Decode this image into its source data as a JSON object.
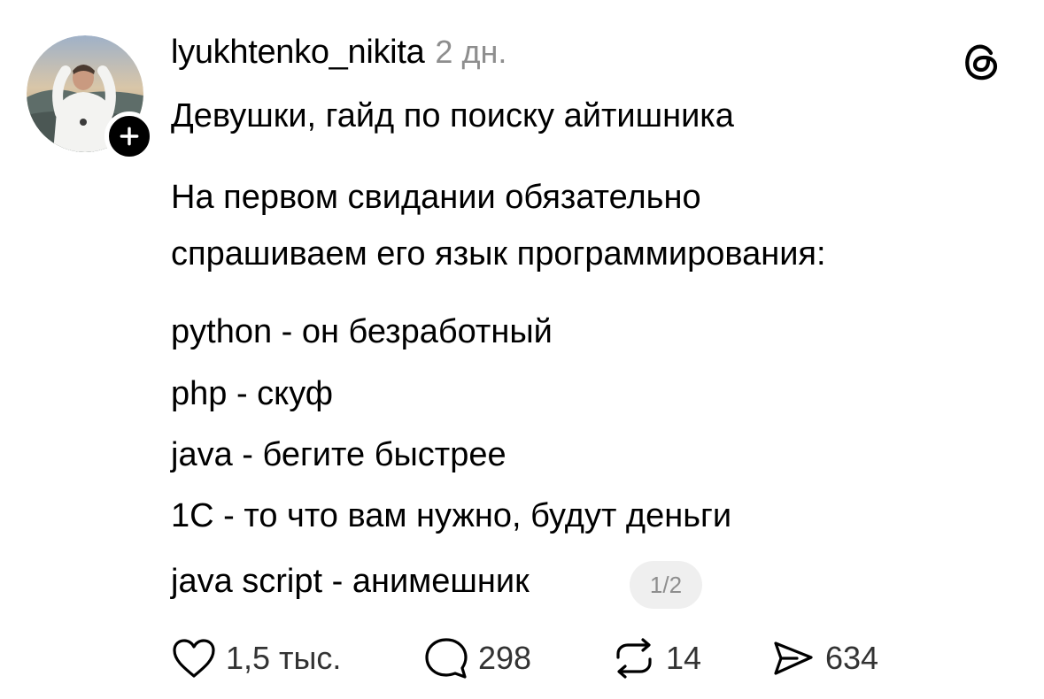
{
  "post": {
    "author": "lyukhtenko_nikita",
    "time": "2 дн.",
    "lines": [
      "Девушки, гайд по поиску айтишника",
      "На первом свидании обязательно",
      "спрашиваем его язык программирования:",
      "python - он безработный",
      "php - скуф",
      "java - бегите быстрее",
      "1С - то что вам нужно, будут деньги",
      "java script - анимешник"
    ],
    "page_indicator": "1/2"
  },
  "actions": {
    "likes": "1,5 тыс.",
    "comments": "298",
    "reposts": "14",
    "shares": "634"
  },
  "icons": {
    "like": "heart-icon",
    "comment": "comment-bubble-icon",
    "repost": "repost-icon",
    "share": "send-icon",
    "brand": "threads-logo-icon",
    "follow": "plus-icon"
  }
}
